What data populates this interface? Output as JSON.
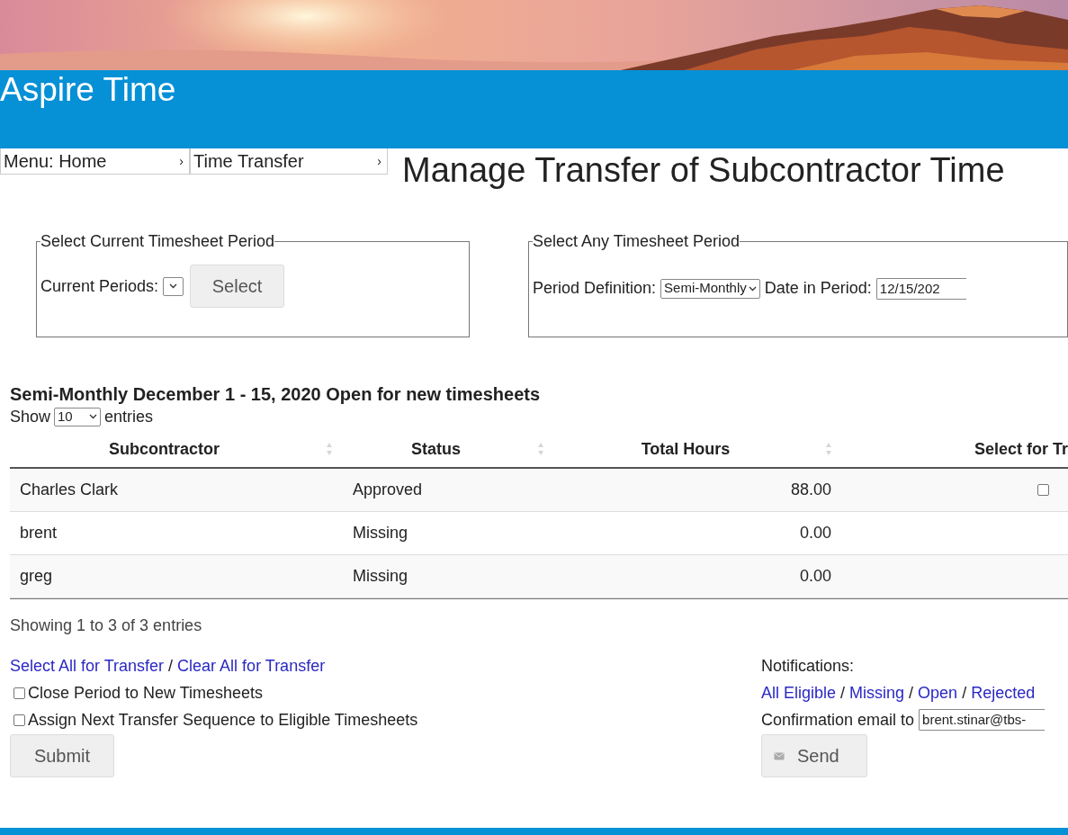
{
  "app": {
    "title": "Aspire Time"
  },
  "breadcrumb": [
    {
      "label": "Menu: Home",
      "arrow": "›"
    },
    {
      "label": "Time Transfer",
      "arrow": "›"
    }
  ],
  "page_title": "Manage Transfer of Subcontractor Time",
  "current_period": {
    "legend": "Select Current Timesheet Period",
    "label": "Current Periods:",
    "button": "Select"
  },
  "any_period": {
    "legend": "Select Any Timesheet Period",
    "definition_label": "Period Definition:",
    "definition_value": "Semi-Monthly",
    "date_label": "Date in Period:",
    "date_value": "12/15/202"
  },
  "period_heading": "Semi-Monthly December 1 - 15, 2020 Open for new timesheets",
  "length": {
    "prefix": "Show",
    "value": "10",
    "suffix": "entries"
  },
  "table": {
    "columns": [
      "Subcontractor",
      "Status",
      "Total Hours",
      "Select for Tr"
    ],
    "rows": [
      {
        "name": "Charles Clark",
        "status": "Approved",
        "hours": "88.00",
        "select": {
          "checked": false
        }
      },
      {
        "name": "brent",
        "status": "Missing",
        "hours": "0.00"
      },
      {
        "name": "greg",
        "status": "Missing",
        "hours": "0.00"
      }
    ]
  },
  "info": "Showing 1 to 3 of 3 entries",
  "bulk_links": [
    "Select All for Transfer",
    "Clear All for Transfer"
  ],
  "bulk_separator": "/",
  "options": [
    {
      "label": "Close Period to New Timesheets",
      "checked": false
    },
    {
      "label": "Assign Next Transfer Sequence to Eligible Timesheets",
      "checked": false
    }
  ],
  "submit": "Submit",
  "notifications": {
    "label": "Notifications:",
    "links": [
      "All Eligible",
      "Missing",
      "Open",
      "Rejected"
    ],
    "separators": [
      "/",
      "/",
      "/"
    ],
    "email_label": "Confirmation email to",
    "email_value": "brent.stinar@tbs-",
    "send": "Send"
  }
}
